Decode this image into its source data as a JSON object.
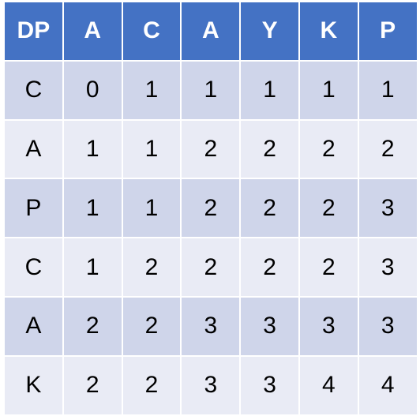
{
  "chart_data": {
    "type": "table",
    "header": [
      "DP",
      "A",
      "C",
      "A",
      "Y",
      "K",
      "P"
    ],
    "rows": [
      {
        "label": "C",
        "values": [
          0,
          1,
          1,
          1,
          1,
          1
        ]
      },
      {
        "label": "A",
        "values": [
          1,
          1,
          2,
          2,
          2,
          2
        ]
      },
      {
        "label": "P",
        "values": [
          1,
          1,
          2,
          2,
          2,
          3
        ]
      },
      {
        "label": "C",
        "values": [
          1,
          2,
          2,
          2,
          2,
          3
        ]
      },
      {
        "label": "A",
        "values": [
          2,
          2,
          3,
          3,
          3,
          3
        ]
      },
      {
        "label": "K",
        "values": [
          2,
          2,
          3,
          3,
          4,
          4
        ]
      }
    ],
    "colors": {
      "header_bg": "#4472c4",
      "row_band_dark": "#cfd5ea",
      "row_band_light": "#e9ebf5"
    }
  }
}
